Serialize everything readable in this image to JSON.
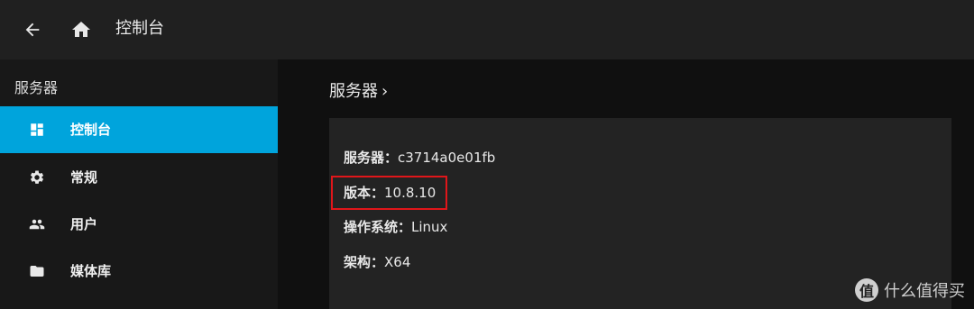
{
  "header": {
    "title": "控制台",
    "back_icon": "arrow-left-icon",
    "home_icon": "home-icon"
  },
  "sidebar": {
    "heading": "服务器",
    "items": [
      {
        "label": "控制台",
        "icon": "dashboard-icon",
        "active": true
      },
      {
        "label": "常规",
        "icon": "gear-icon",
        "active": false
      },
      {
        "label": "用户",
        "icon": "people-icon",
        "active": false
      },
      {
        "label": "媒体库",
        "icon": "folder-icon",
        "active": false
      }
    ]
  },
  "main": {
    "breadcrumb": "服务器",
    "breadcrumb_chevron": "›",
    "info": [
      {
        "key": "服务器：",
        "value": "c3714a0e01fb"
      },
      {
        "key": "版本：",
        "value": "10.8.10"
      },
      {
        "key": "操作系统：",
        "value": "Linux"
      },
      {
        "key": "架构：",
        "value": "X64"
      }
    ]
  },
  "watermark": {
    "badge": "值",
    "text": "什么值得买"
  },
  "colors": {
    "accent": "#00a4dc",
    "highlight": "#e0161a",
    "header_bg": "#202020",
    "sidebar_bg": "#181818",
    "card_bg": "#232323"
  }
}
